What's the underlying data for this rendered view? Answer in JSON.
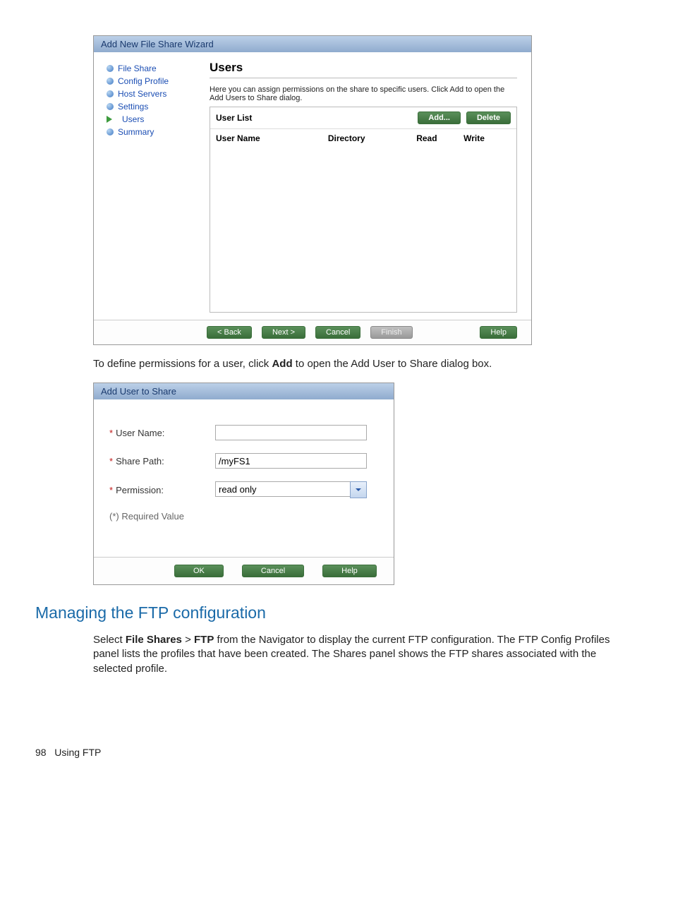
{
  "wizard": {
    "title": "Add New File Share Wizard",
    "steps": [
      "File Share",
      "Config Profile",
      "Host Servers",
      "Settings",
      "Users",
      "Summary"
    ],
    "activeIndex": 4,
    "main": {
      "heading": "Users",
      "description": "Here you can assign permissions on the share to specific users. Click Add to open the Add Users to Share dialog.",
      "userListTitle": "User List",
      "addLabel": "Add...",
      "deleteLabel": "Delete",
      "cols": [
        "User Name",
        "Directory",
        "Read",
        "Write"
      ]
    },
    "footer": {
      "back": "< Back",
      "next": "Next >",
      "cancel": "Cancel",
      "finish": "Finish",
      "help": "Help"
    }
  },
  "bodyText1_a": "To define permissions for a user, click ",
  "bodyText1_b": "Add",
  "bodyText1_c": " to open the Add User to Share dialog box.",
  "dialog2": {
    "title": "Add User to Share",
    "fields": {
      "userNameLabel": "User Name:",
      "sharePathLabel": "Share Path:",
      "sharePathValue": "/myFS1",
      "permissionLabel": "Permission:",
      "permissionValue": "read only"
    },
    "requiredNote": "(*) Required Value",
    "footer": {
      "ok": "OK",
      "cancel": "Cancel",
      "help": "Help"
    }
  },
  "section": {
    "heading": "Managing the FTP configuration",
    "para_a": "Select ",
    "para_b": "File Shares",
    "para_c": " > ",
    "para_d": "FTP",
    "para_e": " from the Navigator to display the current FTP configuration. The FTP Config Profiles panel lists the profiles that have been created. The Shares panel shows the FTP shares associated with the selected profile."
  },
  "pageFooter": {
    "num": "98",
    "label": "Using FTP"
  }
}
